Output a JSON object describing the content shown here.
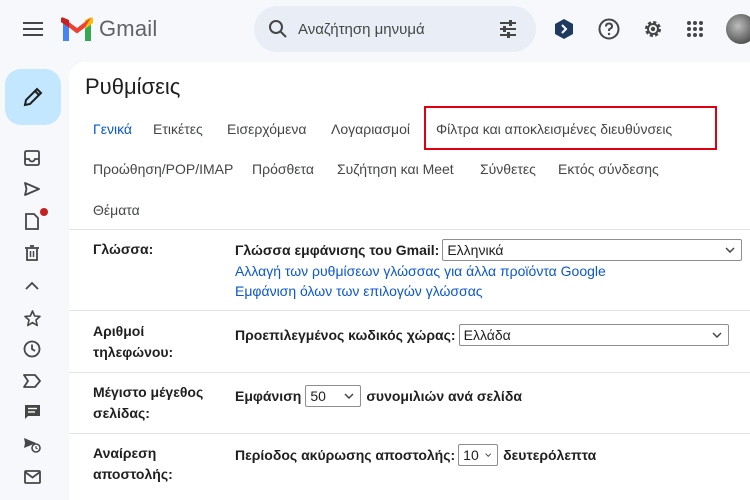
{
  "header": {
    "app_name": "Gmail",
    "search_placeholder": "Αναζήτηση μηνυμά",
    "icons": [
      "menu-icon",
      "gmail-logo",
      "search-icon",
      "tune-icon",
      "gemini-icon",
      "help-icon",
      "settings-icon",
      "apps-icon",
      "account-avatar"
    ]
  },
  "rail": {
    "icons": [
      "compose-pencil-icon",
      "inbox-icon",
      "sent-icon",
      "drafts-icon",
      "trash-icon",
      "collapse-icon",
      "starred-icon",
      "snoozed-icon",
      "important-icon",
      "chat-icon",
      "scheduled-icon",
      "all-mail-icon"
    ]
  },
  "settings": {
    "title": "Ρυθμίσεις",
    "tabs_row1": [
      {
        "label": "Γενικά",
        "active": true
      },
      {
        "label": "Ετικέτες",
        "active": false
      },
      {
        "label": "Εισερχόμενα",
        "active": false
      },
      {
        "label": "Λογαριασμοί",
        "active": false
      },
      {
        "label": "Φίλτρα και αποκλεισμένες διευθύνσεις",
        "active": false
      }
    ],
    "tabs_row2": [
      {
        "label": "Προώθηση/POP/IMAP"
      },
      {
        "label": "Πρόσθετα"
      },
      {
        "label": "Συζήτηση και Meet"
      },
      {
        "label": "Σύνθετες"
      },
      {
        "label": "Εκτός σύνδεσης"
      }
    ],
    "tabs_row3": [
      {
        "label": "Θέματα"
      }
    ],
    "language": {
      "label": "Γλώσσα:",
      "display_label": "Γλώσσα εμφάνισης του Gmail:",
      "display_value": "Ελληνικά",
      "link1": "Αλλαγή των ρυθμίσεων γλώσσας για άλλα προϊόντα Google",
      "link2": "Εμφάνιση όλων των επιλογών γλώσσας"
    },
    "phone": {
      "label_line1": "Αριθμοί",
      "label_line2": "τηλεφώνου:",
      "country_label": "Προεπιλεγμένος κωδικός χώρας:",
      "country_value": "Ελλάδα"
    },
    "page_size": {
      "label_line1": "Μέγιστο μέγεθος",
      "label_line2": "σελίδας:",
      "prefix": "Εμφάνιση",
      "value": "50",
      "suffix": "συνομιλιών ανά σελίδα"
    },
    "undo_send": {
      "label_line1": "Αναίρεση",
      "label_line2": "αποστολής:",
      "prefix": "Περίοδος ακύρωσης αποστολής:",
      "value": "10",
      "suffix": "δευτερόλεπτα"
    }
  },
  "colors": {
    "accent": "#0b57d0",
    "compose_bg": "#c2e7ff",
    "highlight_box": "#e1000f",
    "page_bg": "#f6f8fc"
  }
}
